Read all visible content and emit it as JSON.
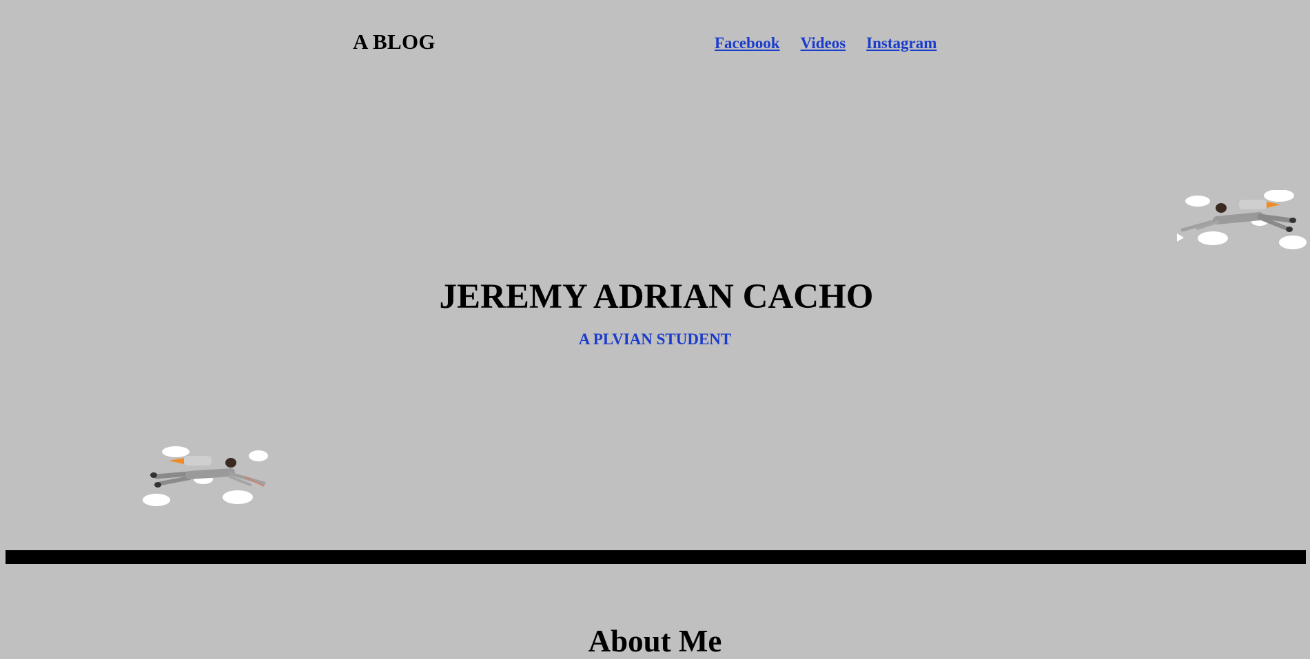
{
  "header": {
    "logo": "A BLOG",
    "nav": [
      {
        "label": "Facebook"
      },
      {
        "label": "Videos"
      },
      {
        "label": "Instagram"
      }
    ]
  },
  "hero": {
    "title": "JEREMY ADRIAN CACHO",
    "subtitle": "A PLVIAN STUDENT"
  },
  "about": {
    "title": "About Me"
  },
  "decorations": {
    "flyer_icon": "jetpack-flyer-icon",
    "cloud_icon": "cloud-icon"
  }
}
